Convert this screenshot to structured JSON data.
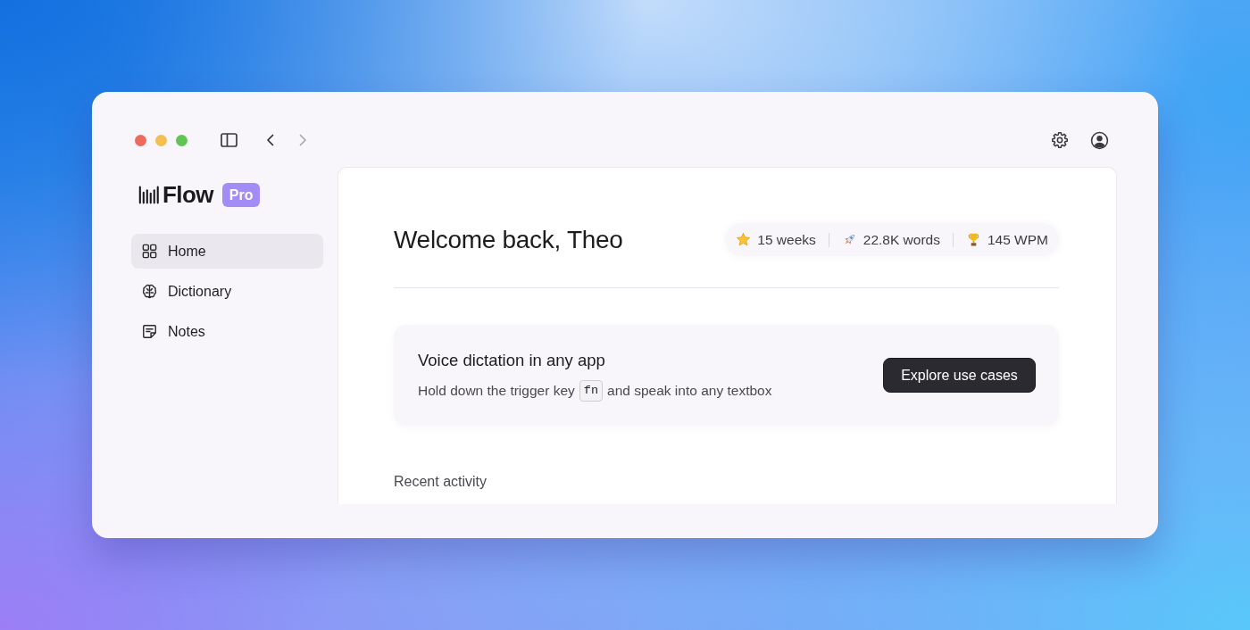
{
  "history_buttons": [
    {
      "disabled": false
    },
    {
      "disabled": true
    }
  ],
  "sidebar": {
    "logo": "Flow",
    "badge": "Pro",
    "items": [
      {
        "label": "Home",
        "selected": true
      },
      {
        "label": "Dictionary",
        "selected": false
      },
      {
        "label": "Notes",
        "selected": false
      }
    ]
  },
  "main": {
    "greeting": "Welcome back, Theo",
    "stats": [
      "15 weeks",
      "22.8K words",
      "145 WPM"
    ],
    "promo": {
      "title": "Voice dictation in any app",
      "hint_before": "Hold down the trigger key",
      "key": "fn",
      "hint_after": "and speak into any textbox",
      "button": "Explore use cases"
    },
    "section_title": "Recent activity"
  }
}
